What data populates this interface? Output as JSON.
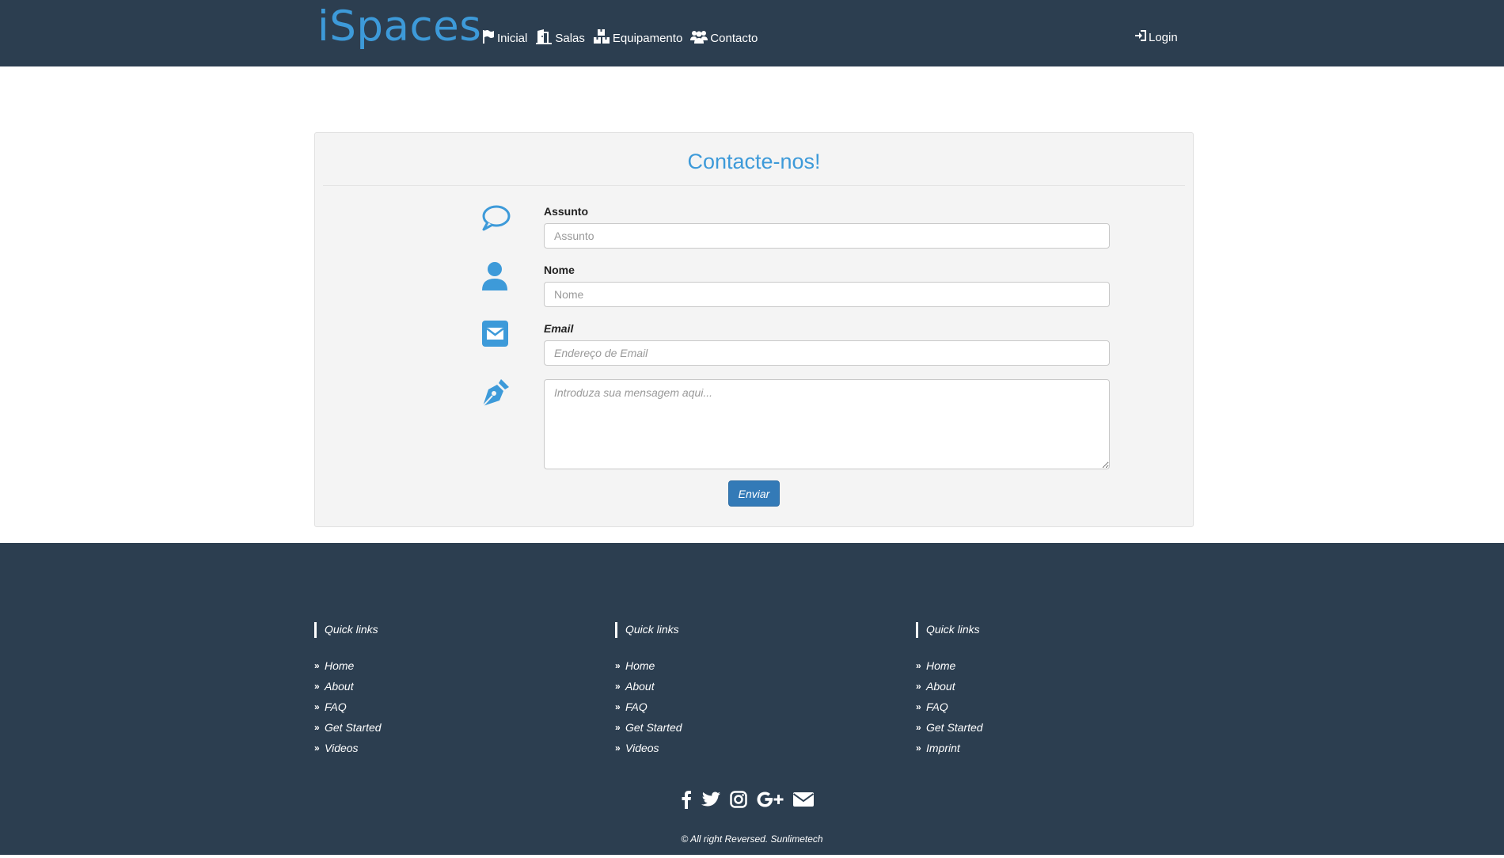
{
  "navbar": {
    "brand": "iSpaces",
    "links": [
      {
        "label": "Inicial",
        "icon": "flag-icon"
      },
      {
        "label": "Salas",
        "icon": "door-icon"
      },
      {
        "label": "Equipamento",
        "icon": "boxes-icon"
      },
      {
        "label": "Contacto",
        "icon": "users-icon"
      }
    ],
    "login": {
      "label": "Login",
      "icon": "login-icon"
    }
  },
  "contact": {
    "title": "Contacte-nos!",
    "fields": {
      "subject": {
        "label": "Assunto",
        "placeholder": "Assunto",
        "icon": "speech-bubble-icon"
      },
      "name": {
        "label": "Nome",
        "placeholder": "Nome",
        "icon": "user-icon"
      },
      "email": {
        "label": "Email",
        "placeholder": "Endereço de Email",
        "icon": "envelope-icon"
      },
      "message": {
        "placeholder": "Introduza sua mensagem aqui...",
        "icon": "pen-icon"
      }
    },
    "submit_label": "Enviar"
  },
  "footer": {
    "columns": [
      {
        "heading": "Quick links",
        "items": [
          "Home",
          "About",
          "FAQ",
          "Get Started",
          "Videos"
        ]
      },
      {
        "heading": "Quick links",
        "items": [
          "Home",
          "About",
          "FAQ",
          "Get Started",
          "Videos"
        ]
      },
      {
        "heading": "Quick links",
        "items": [
          "Home",
          "About",
          "FAQ",
          "Get Started",
          "Imprint"
        ]
      }
    ],
    "social": [
      "facebook-icon",
      "twitter-icon",
      "instagram-icon",
      "google-plus-icon",
      "envelope-icon"
    ],
    "copyright": "© All right Reversed.",
    "company": "Sunlimetech"
  },
  "colors": {
    "navbar_bg": "#2c3e50",
    "accent": "#3d9ad9",
    "button": "#337ab7",
    "panel_bg": "#f4f4f4"
  }
}
